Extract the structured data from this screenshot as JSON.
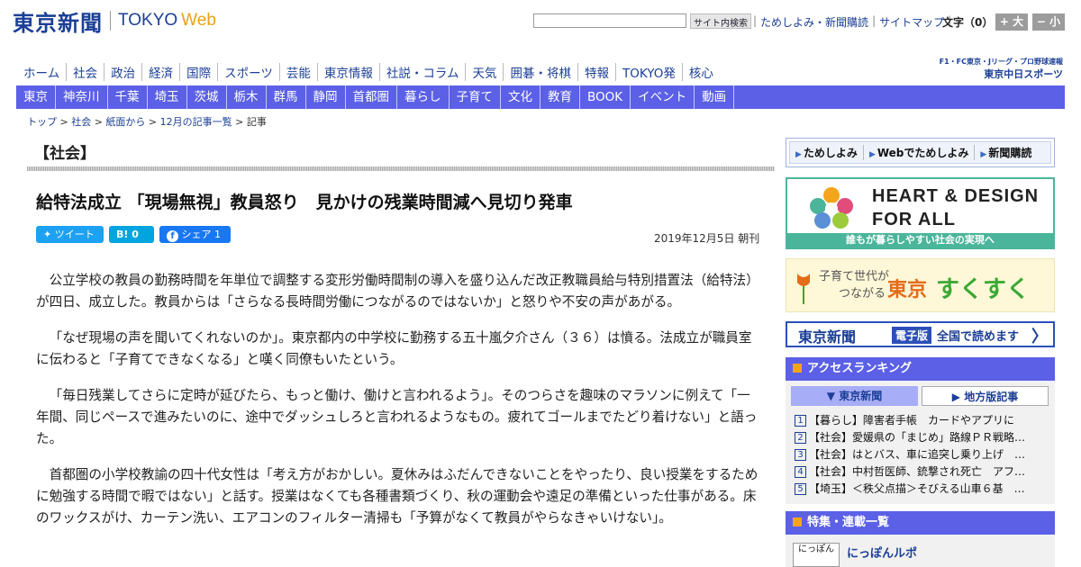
{
  "header": {
    "logo_ja": "東京新聞",
    "logo_en": "TOKYO",
    "logo_web": "Web",
    "search_button": "サイト内検索",
    "top_links": [
      "ためしよみ・新聞購読",
      "サイトマップ"
    ],
    "font_size_label": "文字（0）",
    "font_bigger": "+ 大",
    "font_smaller": "− 小"
  },
  "main_nav": [
    "ホーム",
    "社会",
    "政治",
    "経済",
    "国際",
    "スポーツ",
    "芸能",
    "東京情報",
    "社説・コラム",
    "天気",
    "囲碁・将棋",
    "特報",
    "TOKYO発",
    "核心"
  ],
  "chunichi": {
    "line1": "F1・FC東京・Jリーグ・プロ野球速報",
    "line2": "東京中日スポーツ"
  },
  "sub_nav": [
    "東京",
    "神奈川",
    "千葉",
    "埼玉",
    "茨城",
    "栃木",
    "群馬",
    "静岡",
    "首都圏",
    "暮らし",
    "子育て",
    "文化",
    "教育",
    "BOOK",
    "イベント",
    "動画"
  ],
  "breadcrumb": [
    "トップ",
    "社会",
    "紙面から",
    "12月の記事一覧",
    "記事"
  ],
  "article": {
    "section": "【社会】",
    "headline": "給特法成立 「現場無視」教員怒り　見かけの残業時間減へ見切り発車",
    "share": {
      "tweet": "ツイート",
      "hatena": "B! 0",
      "facebook": "シェア 1"
    },
    "date": "2019年12月5日 朝刊",
    "paragraphs": [
      "公立学校の教員の勤務時間を年単位で調整する変形労働時間制の導入を盛り込んだ改正教職員給与特別措置法（給特法）が四日、成立した。教員からは「さらなる長時間労働につながるのではないか」と怒りや不安の声があがる。",
      "「なぜ現場の声を聞いてくれないのか」。東京都内の中学校に勤務する五十嵐夕介さん（３６）は憤る。法成立が職員室に伝わると「子育てできなくなる」と嘆く同僚もいたという。",
      "「毎日残業してさらに定時が延びたら、もっと働け、働けと言われるよう」。そのつらさを趣味のマラソンに例えて「一年間、同じペースで進みたいのに、途中でダッシュしろと言われるようなもの。疲れてゴールまでたどり着けない」と語った。",
      "首都圏の小学校教諭の四十代女性は「考え方がおかしい。夏休みはふだんできないことをやったり、良い授業をするために勉強する時間で暇ではない」と話す。授業はなくても各種書類づくり、秋の運動会や遠足の準備といった仕事がある。床のワックスがけ、カーテン洗い、エアコンのフィルター清掃も「予算がなくて教員がやらなきゃいけない」。"
    ]
  },
  "sidebar": {
    "links": [
      "ためしよみ",
      "Webでためしよみ",
      "新聞購読"
    ],
    "heart_line1": "HEART & DESIGN",
    "heart_line2": "FOR ALL",
    "heart_band": "誰もが暮らしやすい社会の実現へ",
    "sukusuku": {
      "l1": "子育て世代が",
      "l2": "つながる",
      "tokyo": "東京",
      "name": "すくすく"
    },
    "denshi": {
      "logo": "東京新聞",
      "tag": "電子版",
      "text": "全国で読めます",
      "chev": "〉"
    },
    "ranking": {
      "title": "アクセスランキング",
      "tab_active": "東京新聞",
      "tab_inactive": "地方版記事",
      "items": [
        {
          "n": "1",
          "text": "【暮らし】障害者手帳　カードやアプリに"
        },
        {
          "n": "2",
          "text": "【社会】愛媛県の「まじめ」路線ＰＲ戦略…"
        },
        {
          "n": "3",
          "text": "【社会】はとバス、車に追突し乗り上げ　…"
        },
        {
          "n": "4",
          "text": "【社会】中村哲医師、銃撃され死亡　アフ…"
        },
        {
          "n": "5",
          "text": "【埼玉】＜秩父点描＞そびえる山車６基　…"
        }
      ]
    },
    "features": {
      "title": "特集・連載一覧",
      "thumb": "にっぽん",
      "item": "にっぽんルポ"
    }
  },
  "colors": {
    "brand_blue": "#1b3f96",
    "nav_purple": "#5b60e6",
    "web_orange": "#e8a318",
    "heart_green": "#4bb59b"
  }
}
